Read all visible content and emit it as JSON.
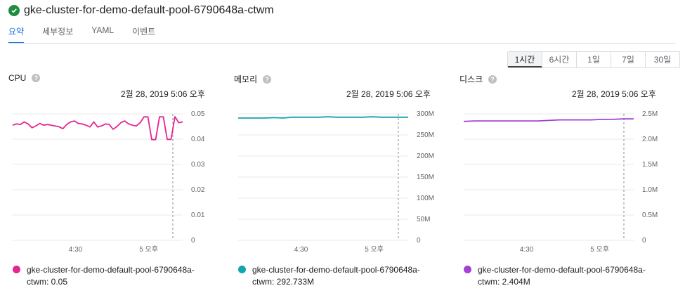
{
  "header": {
    "title": "gke-cluster-for-demo-default-pool-6790648a-ctwm",
    "status_icon": "check-circle-icon",
    "status_color": "#1e8e3e"
  },
  "tabs": [
    {
      "label": "요약",
      "active": true
    },
    {
      "label": "세부정보",
      "active": false
    },
    {
      "label": "YAML",
      "active": false
    },
    {
      "label": "이벤트",
      "active": false
    }
  ],
  "time_range": {
    "options": [
      "1시간",
      "6시간",
      "1일",
      "7일",
      "30일"
    ],
    "selected": "1시간"
  },
  "panels": [
    {
      "title": "CPU",
      "timestamp": "2월 28, 2019 5:06 오후",
      "legend": "gke-cluster-for-demo-default-pool-6790648a-ctwm: 0.05"
    },
    {
      "title": "메모리",
      "timestamp": "2월 28, 2019 5:06 오후",
      "legend": "gke-cluster-for-demo-default-pool-6790648a-ctwm: 292.733M"
    },
    {
      "title": "디스크",
      "timestamp": "2월 28, 2019 5:06 오후",
      "legend": "gke-cluster-for-demo-default-pool-6790648a-ctwm: 2.404M"
    }
  ],
  "chart_data": [
    {
      "type": "line",
      "title": "CPU",
      "x_ticks": [
        "4:30",
        "5 오후"
      ],
      "y_ticks": [
        "0",
        "0.01",
        "0.02",
        "0.03",
        "0.04",
        "0.05"
      ],
      "ylim": [
        0,
        0.05
      ],
      "color": "#e52592",
      "series": [
        {
          "name": "gke-cluster-for-demo-default-pool-6790648a-ctwm",
          "values": [
            0.0455,
            0.046,
            0.0458,
            0.0468,
            0.046,
            0.0445,
            0.0452,
            0.0462,
            0.0455,
            0.0458,
            0.0455,
            0.0452,
            0.0449,
            0.0441,
            0.0458,
            0.0468,
            0.0472,
            0.0462,
            0.046,
            0.0455,
            0.0448,
            0.0468,
            0.0448,
            0.0452,
            0.046,
            0.0458,
            0.0439,
            0.045,
            0.0465,
            0.0472,
            0.046,
            0.0455,
            0.0452,
            0.0465,
            0.0488,
            0.0488,
            0.0398,
            0.0398,
            0.0488,
            0.0488,
            0.0399,
            0.0399,
            0.0489,
            0.0465,
            0.0468
          ]
        }
      ],
      "marker_label": "2월 28, 2019 5:06 오후"
    },
    {
      "type": "line",
      "title": "메모리",
      "x_ticks": [
        "4:30",
        "5 오후"
      ],
      "y_ticks": [
        "0",
        "50M",
        "100M",
        "150M",
        "200M",
        "250M",
        "300M"
      ],
      "ylim": [
        0,
        300
      ],
      "color": "#12a4af",
      "series": [
        {
          "name": "gke-cluster-for-demo-default-pool-6790648a-ctwm",
          "values": [
            290,
            290,
            290,
            290,
            291,
            290,
            292,
            292,
            292,
            292,
            293,
            292,
            292,
            292,
            292,
            293,
            292,
            292,
            292,
            292
          ]
        }
      ],
      "marker_label": "2월 28, 2019 5:06 오후"
    },
    {
      "type": "line",
      "title": "디스크",
      "x_ticks": [
        "4:30",
        "5 오후"
      ],
      "y_ticks": [
        "0",
        "0.5M",
        "1.0M",
        "1.5M",
        "2.0M",
        "2.5M"
      ],
      "ylim": [
        0,
        2.5
      ],
      "color": "#a142d4",
      "series": [
        {
          "name": "gke-cluster-for-demo-default-pool-6790648a-ctwm",
          "values": [
            2.35,
            2.36,
            2.36,
            2.36,
            2.36,
            2.36,
            2.36,
            2.36,
            2.37,
            2.38,
            2.38,
            2.38,
            2.38,
            2.39,
            2.39,
            2.4,
            2.4
          ]
        }
      ],
      "marker_label": "2월 28, 2019 5:06 오후"
    }
  ]
}
